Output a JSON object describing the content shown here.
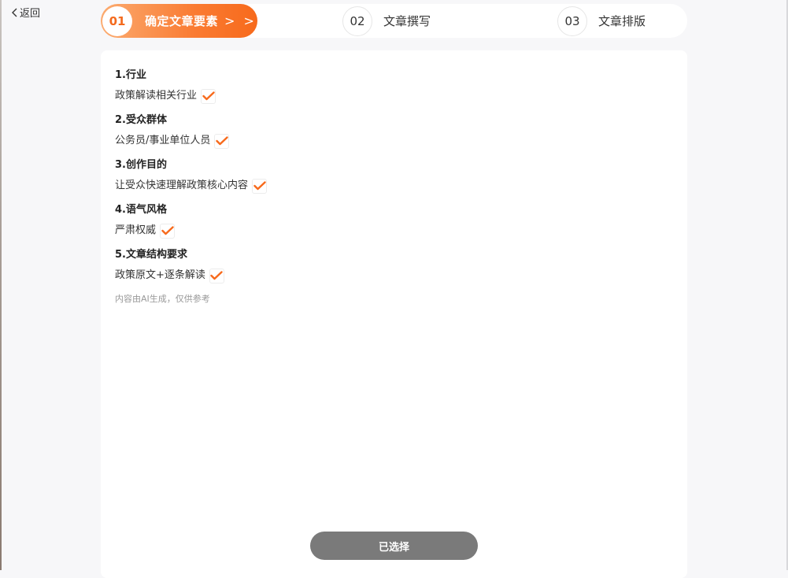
{
  "nav": {
    "back_label": "返回"
  },
  "steps": [
    {
      "number": "01",
      "label": "确定文章要素",
      "arrows": "> >",
      "active": true
    },
    {
      "number": "02",
      "label": "文章撰写",
      "active": false
    },
    {
      "number": "03",
      "label": "文章排版",
      "active": false
    }
  ],
  "elements": [
    {
      "title": "1.行业",
      "value": "政策解读相关行业",
      "checked": true
    },
    {
      "title": "2.受众群体",
      "value": "公务员/事业单位人员",
      "checked": true
    },
    {
      "title": "3.创作目的",
      "value": "让受众快速理解政策核心内容",
      "checked": true
    },
    {
      "title": "4.语气风格",
      "value": "严肃权威",
      "checked": true
    },
    {
      "title": "5.文章结构要求",
      "value": "政策原文+逐条解读",
      "checked": true
    }
  ],
  "disclaimer": "内容由AI生成，仅供参考",
  "actions": {
    "selected_label": "已选择"
  },
  "colors": {
    "accent": "#f76a1c",
    "accent_light": "#fbab70",
    "button_gray": "#7a7a7a"
  }
}
